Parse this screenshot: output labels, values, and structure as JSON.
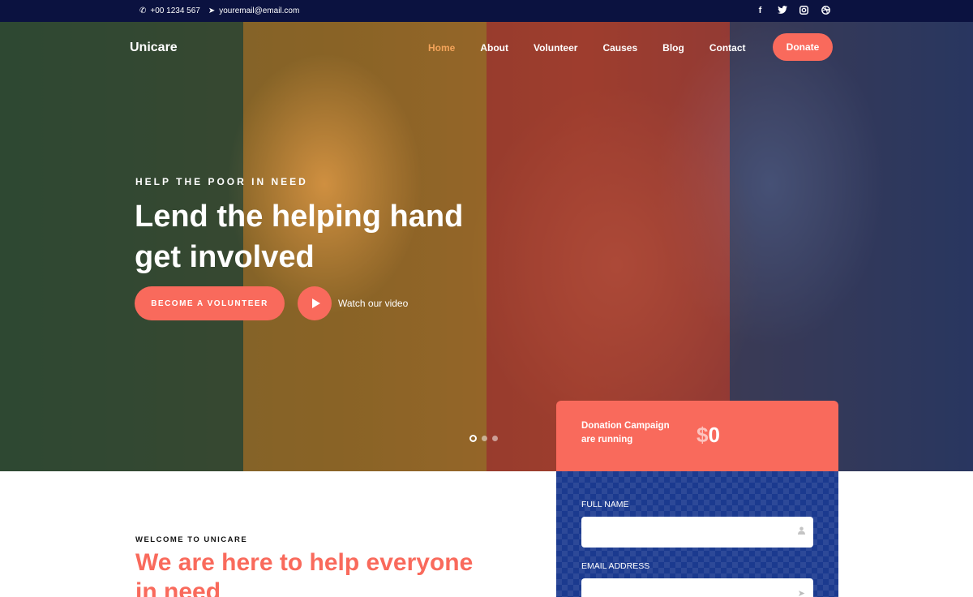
{
  "topbar": {
    "phone": "+00 1234 567",
    "email": "youremail@email.com",
    "social": [
      "f",
      "t",
      "ig",
      "db"
    ]
  },
  "brand": "Unicare",
  "nav": {
    "items": [
      "Home",
      "About",
      "Volunteer",
      "Causes",
      "Blog",
      "Contact"
    ],
    "active": "Home",
    "donate": "Donate"
  },
  "hero": {
    "kicker": "HELP THE POOR IN NEED",
    "headline_line1": "Lend the helping hand",
    "headline_line2": "get involved",
    "volunteer_button": "BECOME A VOLUNTEER",
    "watch_video": "Watch our video",
    "slides": 3,
    "active_slide": 1,
    "band_colors": [
      "#2e5438",
      "#d69628",
      "#c83c32",
      "#283c6e"
    ]
  },
  "donation_card": {
    "campaign_line1": "Donation Campaign",
    "campaign_line2": "are running",
    "currency": "$",
    "amount": "0",
    "full_name_label": "FULL NAME",
    "email_label": "EMAIL ADDRESS"
  },
  "welcome": {
    "kicker": "WELCOME TO UNICARE",
    "title": "We are here to help everyone in need"
  },
  "colors": {
    "accent": "#f96a5c",
    "topbar": "#0b1240",
    "form_bg": "#1b3a8f",
    "nav_active": "#f4a45a"
  }
}
